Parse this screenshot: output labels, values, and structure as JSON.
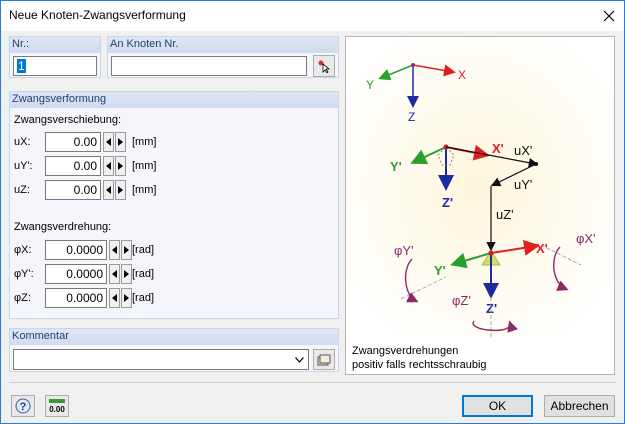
{
  "window": {
    "title": "Neue Knoten-Zwangsverformung"
  },
  "nr": {
    "label": "Nr.:",
    "value": "1"
  },
  "an_knoten": {
    "label": "An Knoten Nr.",
    "value": ""
  },
  "zwangsverformung": {
    "header": "Zwangsverformung",
    "verschiebung_title": "Zwangsverschiebung:",
    "verschiebung": [
      {
        "label": "uX:",
        "value": "0.00",
        "unit": "[mm]"
      },
      {
        "label": "uY':",
        "value": "0.00",
        "unit": "[mm]"
      },
      {
        "label": "uZ:",
        "value": "0.00",
        "unit": "[mm]"
      }
    ],
    "verdrehung_title": "Zwangsverdrehung:",
    "verdrehung": [
      {
        "label": "φX:",
        "value": "0.0000",
        "unit": "[rad]"
      },
      {
        "label": "φY':",
        "value": "0.0000",
        "unit": "[rad]"
      },
      {
        "label": "φZ:",
        "value": "0.0000",
        "unit": "[rad]"
      }
    ]
  },
  "kommentar": {
    "label": "Kommentar",
    "value": ""
  },
  "figure": {
    "caption_line1": "Zwangsverdrehungen",
    "caption_line2": "positiv falls rechtsschraubig",
    "labels": {
      "X": "X",
      "Y": "Y",
      "Z": "Z",
      "Xp": "X'",
      "Yp": "Y'",
      "Zp": "Z'",
      "uX": "uX'",
      "uY": "uY'",
      "uZ": "uZ'",
      "phiY": "φY'",
      "phiX": "φX'",
      "phiZ": "φZ'"
    }
  },
  "buttons": {
    "ok": "OK",
    "cancel": "Abbrechen",
    "units_icon_text": "0.00"
  },
  "colors": {
    "x_axis": "#e02020",
    "y_axis": "#2aa02a",
    "z_axis": "#1e2aa0",
    "rotation": "#8b2a6a"
  }
}
